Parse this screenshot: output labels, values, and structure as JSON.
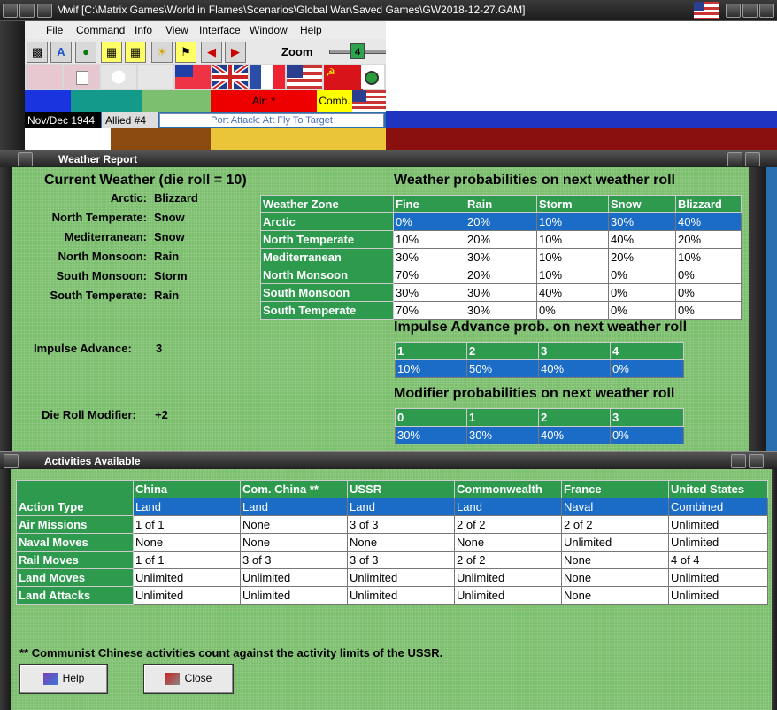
{
  "window": {
    "title": "Mwif [C:\\Matrix Games\\World in Flames\\Scenarios\\Global War\\Saved Games\\GW2018-12-27.GAM]"
  },
  "menu": [
    "File",
    "Command",
    "Info",
    "View",
    "Interface",
    "Window",
    "Help"
  ],
  "toolbar": {
    "zoom_label": "Zoom",
    "zoom_value": "4",
    "tool_icons": [
      "train-icon",
      "air-icon",
      "naval-icon",
      "unit-icon",
      "unit2-icon",
      "sun-icon",
      "flag-icon",
      "back-arrow-icon",
      "forward-arrow-icon"
    ]
  },
  "status": {
    "air_label": "Air: *",
    "comb_label": "Comb.",
    "date": "Nov/Dec 1944",
    "phase": "Allied #4",
    "message": "Port Attack: Att Fly To Target"
  },
  "weather": {
    "panel_title": "Weather Report",
    "current_heading": "Current Weather (die roll = 10)",
    "zones": [
      {
        "label": "Arctic:",
        "value": "Blizzard"
      },
      {
        "label": "North Temperate:",
        "value": "Snow"
      },
      {
        "label": "Mediterranean:",
        "value": "Snow"
      },
      {
        "label": "North Monsoon:",
        "value": "Rain"
      },
      {
        "label": "South Monsoon:",
        "value": "Storm"
      },
      {
        "label": "South Temperate:",
        "value": "Rain"
      }
    ],
    "impulse_label": "Impulse Advance:",
    "impulse_value": "3",
    "modifier_label": "Die Roll Modifier:",
    "modifier_value": "+2",
    "prob_heading": "Weather probabilities on next weather roll",
    "prob_headers": [
      "Weather Zone",
      "Fine",
      "Rain",
      "Storm",
      "Snow",
      "Blizzard"
    ],
    "prob_rows": [
      [
        "Arctic",
        "0%",
        "20%",
        "10%",
        "30%",
        "40%"
      ],
      [
        "North Temperate",
        "10%",
        "20%",
        "10%",
        "40%",
        "20%"
      ],
      [
        "Mediterranean",
        "30%",
        "30%",
        "10%",
        "20%",
        "10%"
      ],
      [
        "North Monsoon",
        "70%",
        "20%",
        "10%",
        "0%",
        "0%"
      ],
      [
        "South Monsoon",
        "30%",
        "30%",
        "40%",
        "0%",
        "0%"
      ],
      [
        "South Temperate",
        "70%",
        "30%",
        "0%",
        "0%",
        "0%"
      ]
    ],
    "impulse_heading": "Impulse Advance prob. on next weather roll",
    "impulse_headers": [
      "1",
      "2",
      "3",
      "4"
    ],
    "impulse_row": [
      "10%",
      "50%",
      "40%",
      "0%"
    ],
    "modifier_heading": "Modifier probabilities on next weather roll",
    "modifier_headers": [
      "0",
      "1",
      "2",
      "3"
    ],
    "modifier_row": [
      "30%",
      "30%",
      "40%",
      "0%"
    ]
  },
  "activities": {
    "panel_title": "Activities Available",
    "headers": [
      "",
      "China",
      "Com. China **",
      "USSR",
      "Commonwealth",
      "France",
      "United States"
    ],
    "rows": [
      [
        "Action Type",
        "Land",
        "Land",
        "Land",
        "Land",
        "Naval",
        "Combined"
      ],
      [
        "Air Missions",
        "1 of 1",
        "None",
        "3 of 3",
        "2 of 2",
        "2 of 2",
        "Unlimited"
      ],
      [
        "Naval Moves",
        "None",
        "None",
        "None",
        "None",
        "Unlimited",
        "Unlimited"
      ],
      [
        "Rail Moves",
        "1 of 1",
        "3 of 3",
        "3 of 3",
        "2 of 2",
        "None",
        "4 of 4"
      ],
      [
        "Land Moves",
        "Unlimited",
        "Unlimited",
        "Unlimited",
        "Unlimited",
        "None",
        "Unlimited"
      ],
      [
        "Land Attacks",
        "Unlimited",
        "Unlimited",
        "Unlimited",
        "Unlimited",
        "None",
        "Unlimited"
      ]
    ],
    "footnote": "** Communist Chinese activities count against the activity limits of the USSR.",
    "help_label": "Help",
    "close_label": "Close"
  }
}
